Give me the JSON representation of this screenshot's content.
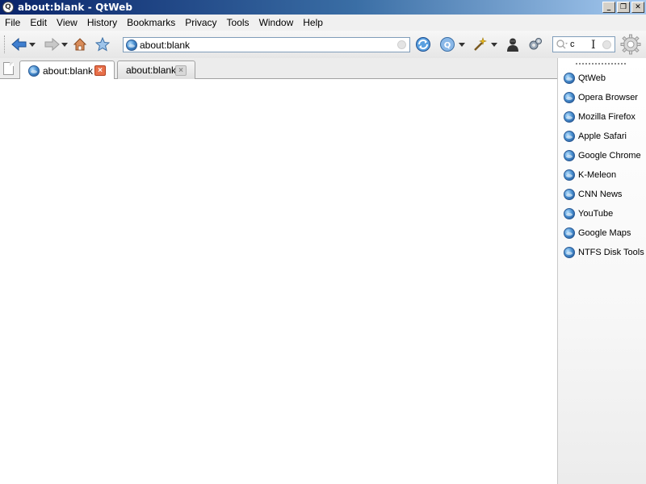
{
  "window": {
    "title": "about:blank - QtWeb"
  },
  "menu": [
    "File",
    "Edit",
    "View",
    "History",
    "Bookmarks",
    "Privacy",
    "Tools",
    "Window",
    "Help"
  ],
  "toolbar": {
    "address_value": "about:blank",
    "search_value": "c"
  },
  "tabs": [
    {
      "label": "about:blank",
      "active": true
    },
    {
      "label": "about:blank",
      "active": false
    }
  ],
  "bookmarks": [
    "QtWeb",
    "Opera Browser",
    "Mozilla Firefox",
    "Apple Safari",
    "Google Chrome",
    "K-Meleon",
    "CNN News",
    "YouTube",
    "Google Maps",
    "NTFS Disk Tools"
  ],
  "colors": {
    "titlebar_start": "#0a246a",
    "titlebar_end": "#a6caf0",
    "active_tab_close": "#e8704a",
    "link_globe": "#4a90d0"
  }
}
